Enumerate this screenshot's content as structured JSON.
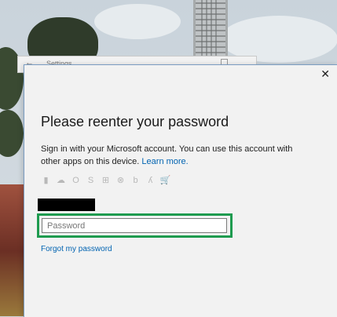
{
  "settings_window": {
    "title": "Settings",
    "back_glyph": "←"
  },
  "dialog": {
    "close_glyph": "✕",
    "heading": "Please reenter your password",
    "description": "Sign in with your Microsoft account. You can use this account with other apps on this device.",
    "learn_more": "Learn more.",
    "app_icons": [
      {
        "name": "office-icon",
        "glyph": "▮"
      },
      {
        "name": "onedrive-icon",
        "glyph": "☁"
      },
      {
        "name": "outlook-icon",
        "glyph": "O"
      },
      {
        "name": "skype-icon",
        "glyph": "S"
      },
      {
        "name": "windows-icon",
        "glyph": "⊞"
      },
      {
        "name": "xbox-icon",
        "glyph": "⊗"
      },
      {
        "name": "bing-icon",
        "glyph": "b"
      },
      {
        "name": "msn-icon",
        "glyph": "ʎ"
      },
      {
        "name": "store-icon",
        "glyph": "🛒"
      }
    ],
    "password_placeholder": "Password",
    "password_value": "",
    "forgot_link": "Forgot my password"
  },
  "colors": {
    "accent_link": "#0063b1",
    "highlight_frame": "#1e9b4f"
  }
}
